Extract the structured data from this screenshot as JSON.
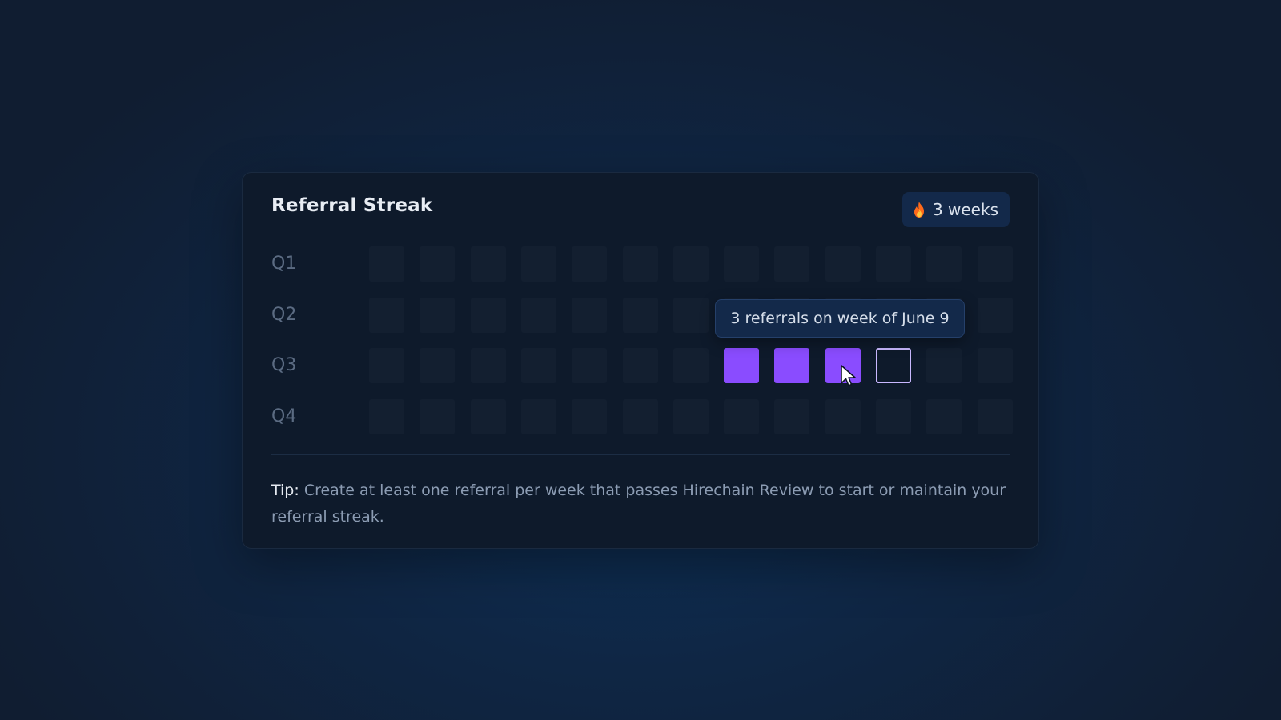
{
  "card": {
    "title": "Referral Streak",
    "streak_badge": {
      "icon": "flame-icon",
      "text": "3 weeks"
    }
  },
  "grid": {
    "rows": [
      {
        "label": "Q1",
        "cells": [
          0,
          0,
          0,
          0,
          0,
          0,
          0,
          0,
          0,
          0,
          0,
          0,
          0
        ]
      },
      {
        "label": "Q2",
        "cells": [
          0,
          0,
          0,
          0,
          0,
          0,
          0,
          0,
          0,
          0,
          0,
          0,
          0
        ]
      },
      {
        "label": "Q3",
        "cells": [
          0,
          0,
          0,
          0,
          0,
          0,
          0,
          1,
          1,
          1,
          2,
          0,
          0
        ]
      },
      {
        "label": "Q4",
        "cells": [
          0,
          0,
          0,
          0,
          0,
          0,
          0,
          0,
          0,
          0,
          0,
          0,
          0
        ]
      }
    ],
    "cell_states": {
      "0": "empty",
      "1": "active",
      "2": "next"
    }
  },
  "tooltip": {
    "text": "3 referrals on week of June 9"
  },
  "tip": {
    "label": "Tip:",
    "text": "Create at least one referral per week that passes Hirechain Review to start or maintain your referral streak."
  },
  "colors": {
    "active": "#8a4cff",
    "empty": "#131f30",
    "next_border": "#c9b8ff",
    "card_bg": "#0e1a2b"
  }
}
